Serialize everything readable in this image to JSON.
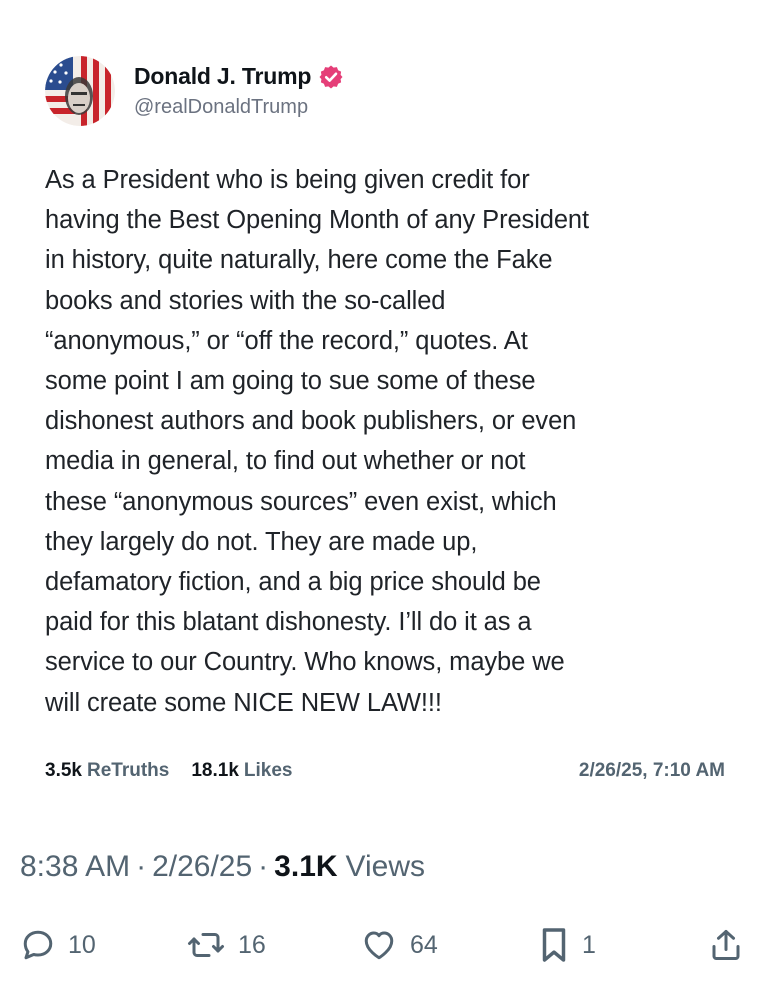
{
  "post": {
    "author_name": "Donald J. Trump",
    "author_handle": "@realDonaldTrump",
    "verified_icon": "verified-badge-icon",
    "text": "As a President who is being given credit for\nhaving the Best Opening Month of any President\nin history, quite naturally, here come the Fake\nbooks and stories with the so-called\n“anonymous,” or “off the record,” quotes. At\nsome point I am going to sue some of these\ndishonest authors and book publishers, or even\nmedia in general, to find out whether or not\nthese “anonymous sources” even exist, which\nthey largely do not. They are made up,\ndefamatory fiction, and a big price should be\npaid for this blatant dishonesty. I’ll do it as a\nservice to our Country. Who knows, maybe we\nwill create some NICE NEW LAW!!!",
    "retruths_count": "3.5k",
    "retruths_label": "ReTruths",
    "likes_count": "18.1k",
    "likes_label": "Likes",
    "posted_at": "2/26/25, 7:10 AM"
  },
  "meta": {
    "time": "8:38 AM",
    "separator": "·",
    "date": "2/26/25",
    "views_count": "3.1K",
    "views_label": "Views"
  },
  "actions": {
    "replies": "10",
    "reposts": "16",
    "likes": "64",
    "bookmarks": "1"
  },
  "colors": {
    "text": "#0f1419",
    "muted": "#536471",
    "verified": "#e53e78"
  }
}
